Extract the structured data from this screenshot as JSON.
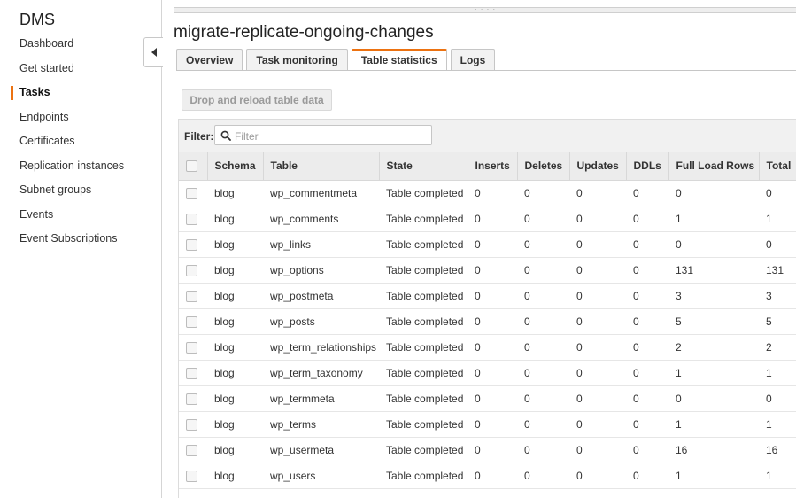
{
  "sidebar": {
    "title": "DMS",
    "items": [
      {
        "label": "Dashboard",
        "active": false
      },
      {
        "label": "Get started",
        "active": false
      },
      {
        "label": "Tasks",
        "active": true
      },
      {
        "label": "Endpoints",
        "active": false
      },
      {
        "label": "Certificates",
        "active": false
      },
      {
        "label": "Replication instances",
        "active": false
      },
      {
        "label": "Subnet groups",
        "active": false
      },
      {
        "label": "Events",
        "active": false
      },
      {
        "label": "Event Subscriptions",
        "active": false
      }
    ]
  },
  "main": {
    "title": "migrate-replicate-ongoing-changes",
    "tabs": [
      {
        "label": "Overview",
        "active": false
      },
      {
        "label": "Task monitoring",
        "active": false
      },
      {
        "label": "Table statistics",
        "active": true
      },
      {
        "label": "Logs",
        "active": false
      }
    ],
    "reload_button": "Drop and reload table data",
    "filter": {
      "label": "Filter:",
      "placeholder": "Filter",
      "value": ""
    }
  },
  "table": {
    "columns": [
      "Schema",
      "Table",
      "State",
      "Inserts",
      "Deletes",
      "Updates",
      "DDLs",
      "Full Load Rows",
      "Total"
    ],
    "rows": [
      [
        "blog",
        "wp_commentmeta",
        "Table completed",
        "0",
        "0",
        "0",
        "0",
        "0",
        "0"
      ],
      [
        "blog",
        "wp_comments",
        "Table completed",
        "0",
        "0",
        "0",
        "0",
        "1",
        "1"
      ],
      [
        "blog",
        "wp_links",
        "Table completed",
        "0",
        "0",
        "0",
        "0",
        "0",
        "0"
      ],
      [
        "blog",
        "wp_options",
        "Table completed",
        "0",
        "0",
        "0",
        "0",
        "131",
        "131"
      ],
      [
        "blog",
        "wp_postmeta",
        "Table completed",
        "0",
        "0",
        "0",
        "0",
        "3",
        "3"
      ],
      [
        "blog",
        "wp_posts",
        "Table completed",
        "0",
        "0",
        "0",
        "0",
        "5",
        "5"
      ],
      [
        "blog",
        "wp_term_relationships",
        "Table completed",
        "0",
        "0",
        "0",
        "0",
        "2",
        "2"
      ],
      [
        "blog",
        "wp_term_taxonomy",
        "Table completed",
        "0",
        "0",
        "0",
        "0",
        "1",
        "1"
      ],
      [
        "blog",
        "wp_termmeta",
        "Table completed",
        "0",
        "0",
        "0",
        "0",
        "0",
        "0"
      ],
      [
        "blog",
        "wp_terms",
        "Table completed",
        "0",
        "0",
        "0",
        "0",
        "1",
        "1"
      ],
      [
        "blog",
        "wp_usermeta",
        "Table completed",
        "0",
        "0",
        "0",
        "0",
        "16",
        "16"
      ],
      [
        "blog",
        "wp_users",
        "Table completed",
        "0",
        "0",
        "0",
        "0",
        "1",
        "1"
      ]
    ]
  },
  "colors": {
    "accent": "#ec7211"
  },
  "icons": {
    "collapse": "caret-left-icon",
    "filter": "search-icon",
    "row_select": "checkbox-icon"
  }
}
